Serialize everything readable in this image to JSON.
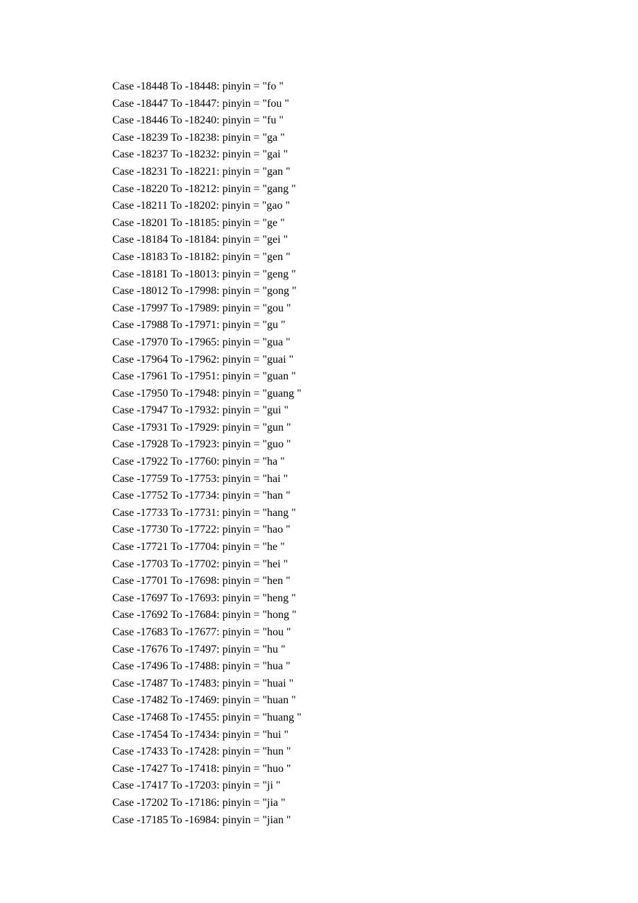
{
  "lines": [
    {
      "from": "-18448",
      "to": "-18448",
      "pinyin": "fo "
    },
    {
      "from": "-18447",
      "to": "-18447",
      "pinyin": "fou "
    },
    {
      "from": "-18446",
      "to": "-18240",
      "pinyin": "fu "
    },
    {
      "from": "-18239",
      "to": "-18238",
      "pinyin": "ga "
    },
    {
      "from": "-18237",
      "to": "-18232",
      "pinyin": "gai "
    },
    {
      "from": "-18231",
      "to": "-18221",
      "pinyin": "gan "
    },
    {
      "from": "-18220",
      "to": "-18212",
      "pinyin": "gang "
    },
    {
      "from": "-18211",
      "to": "-18202",
      "pinyin": "gao "
    },
    {
      "from": "-18201",
      "to": "-18185",
      "pinyin": "ge "
    },
    {
      "from": "-18184",
      "to": "-18184",
      "pinyin": "gei "
    },
    {
      "from": "-18183",
      "to": "-18182",
      "pinyin": "gen "
    },
    {
      "from": "-18181",
      "to": "-18013",
      "pinyin": "geng "
    },
    {
      "from": "-18012",
      "to": "-17998",
      "pinyin": "gong "
    },
    {
      "from": "-17997",
      "to": "-17989",
      "pinyin": "gou "
    },
    {
      "from": "-17988",
      "to": "-17971",
      "pinyin": "gu "
    },
    {
      "from": "-17970",
      "to": "-17965",
      "pinyin": "gua "
    },
    {
      "from": "-17964",
      "to": "-17962",
      "pinyin": "guai "
    },
    {
      "from": "-17961",
      "to": "-17951",
      "pinyin": "guan "
    },
    {
      "from": "-17950",
      "to": "-17948",
      "pinyin": "guang "
    },
    {
      "from": "-17947",
      "to": "-17932",
      "pinyin": "gui "
    },
    {
      "from": "-17931",
      "to": "-17929",
      "pinyin": "gun "
    },
    {
      "from": "-17928",
      "to": "-17923",
      "pinyin": "guo "
    },
    {
      "from": "-17922",
      "to": "-17760",
      "pinyin": "ha "
    },
    {
      "from": "-17759",
      "to": "-17753",
      "pinyin": "hai "
    },
    {
      "from": "-17752",
      "to": "-17734",
      "pinyin": "han "
    },
    {
      "from": "-17733",
      "to": "-17731",
      "pinyin": "hang "
    },
    {
      "from": "-17730",
      "to": "-17722",
      "pinyin": "hao "
    },
    {
      "from": "-17721",
      "to": "-17704",
      "pinyin": "he "
    },
    {
      "from": "-17703",
      "to": "-17702",
      "pinyin": "hei "
    },
    {
      "from": "-17701",
      "to": "-17698",
      "pinyin": "hen "
    },
    {
      "from": "-17697",
      "to": "-17693",
      "pinyin": "heng "
    },
    {
      "from": "-17692",
      "to": "-17684",
      "pinyin": "hong "
    },
    {
      "from": "-17683",
      "to": "-17677",
      "pinyin": "hou "
    },
    {
      "from": "-17676",
      "to": "-17497",
      "pinyin": "hu "
    },
    {
      "from": "-17496",
      "to": "-17488",
      "pinyin": "hua "
    },
    {
      "from": "-17487",
      "to": "-17483",
      "pinyin": "huai "
    },
    {
      "from": "-17482",
      "to": "-17469",
      "pinyin": "huan "
    },
    {
      "from": "-17468",
      "to": "-17455",
      "pinyin": "huang "
    },
    {
      "from": "-17454",
      "to": "-17434",
      "pinyin": "hui "
    },
    {
      "from": "-17433",
      "to": "-17428",
      "pinyin": "hun "
    },
    {
      "from": "-17427",
      "to": "-17418",
      "pinyin": "huo "
    },
    {
      "from": "-17417",
      "to": "-17203",
      "pinyin": "ji "
    },
    {
      "from": "-17202",
      "to": "-17186",
      "pinyin": "jia "
    },
    {
      "from": "-17185",
      "to": "-16984",
      "pinyin": "jian "
    }
  ]
}
